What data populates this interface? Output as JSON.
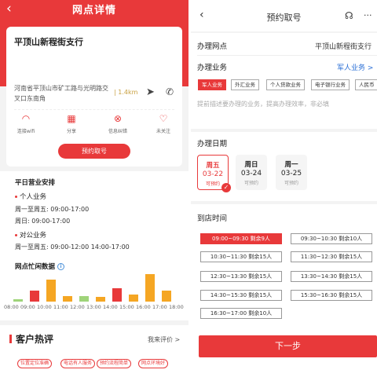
{
  "left": {
    "back_icon": "‹",
    "title": "网点详情",
    "branch_name": "平顶山新程街支行",
    "address": "河南省平顶山市矿工路与光明路交叉口东南角",
    "distance": "| 1.4km",
    "actions": [
      {
        "icon": "wifi-icon",
        "glyph": "◠",
        "label": "连接wifi"
      },
      {
        "icon": "qrcode-icon",
        "glyph": "▦",
        "label": "分享"
      },
      {
        "icon": "error-report-icon",
        "glyph": "⊗",
        "label": "信息纠错"
      },
      {
        "icon": "heart-icon",
        "glyph": "♡",
        "label": "未关注"
      }
    ],
    "book_button": "预约取号",
    "hours": {
      "heading": "平日营业安排",
      "personal_title": "个人业务",
      "personal_weekday": "周一至周五:  09:00-17:00",
      "personal_sunday": "周日:  09:00-17:00",
      "corporate_title": "对公业务",
      "corporate_weekday": "周一至周五:  09:00-12:00   14:00-17:00"
    },
    "busy": {
      "title": "网点忙闲数据",
      "info_icon": "i",
      "hours": [
        "08:00",
        "09:00",
        "10:00",
        "11:00",
        "12:00",
        "13:00",
        "14:00",
        "15:00",
        "16:00",
        "17:00",
        "18:00"
      ],
      "levels": [
        0.08,
        0.4,
        0.78,
        0.2,
        0.2,
        0.16,
        0.48,
        0.24,
        0.97,
        0.4
      ],
      "bar_colors": [
        "#9fd47a",
        "#e8393a",
        "#f5a623",
        "#f5a623",
        "#9fd47a",
        "#f5a623",
        "#e8393a",
        "#f5a623",
        "#f5a623",
        "#f5a623"
      ]
    },
    "reviews": {
      "title": "客户热评",
      "link": "我来评价 >",
      "tags": [
        "位置定位准确",
        "电话有人服务",
        "预约流程简单",
        "网点环境好"
      ]
    }
  },
  "right": {
    "back_icon": "‹",
    "title": "预约取号",
    "headset_icon": "headset-icon",
    "more_icon": "more-icon",
    "branch_label": "办理网点",
    "branch_value": "平顶山新程街支行",
    "business_label": "办理业务",
    "business_value": "军人业务 >",
    "business_chips": [
      "军人业务",
      "外汇业务",
      "个人贷款业务",
      "电子银行业务",
      "人民币"
    ],
    "placeholder": "提前描述要办理的业务，提高办理效率，非必填",
    "date_label": "办理日期",
    "dates": [
      {
        "weekday": "周五",
        "date": "03-22",
        "status": "可预约"
      },
      {
        "weekday": "周日",
        "date": "03-24",
        "status": "可预约"
      },
      {
        "weekday": "周一",
        "date": "03-25",
        "status": "可预约"
      }
    ],
    "time_label": "到店时间",
    "slots": [
      "09:00~09:30  剩余9人",
      "09:30~10:30  剩余10人",
      "10:30~11:30  剩余15人",
      "11:30~12:30  剩余15人",
      "12:30~13:30  剩余15人",
      "13:30~14:30  剩余15人",
      "14:30~15:30  剩余15人",
      "15:30~16:30  剩余15人",
      "16:30~17:00  剩余10人"
    ],
    "next_button": "下一步"
  }
}
